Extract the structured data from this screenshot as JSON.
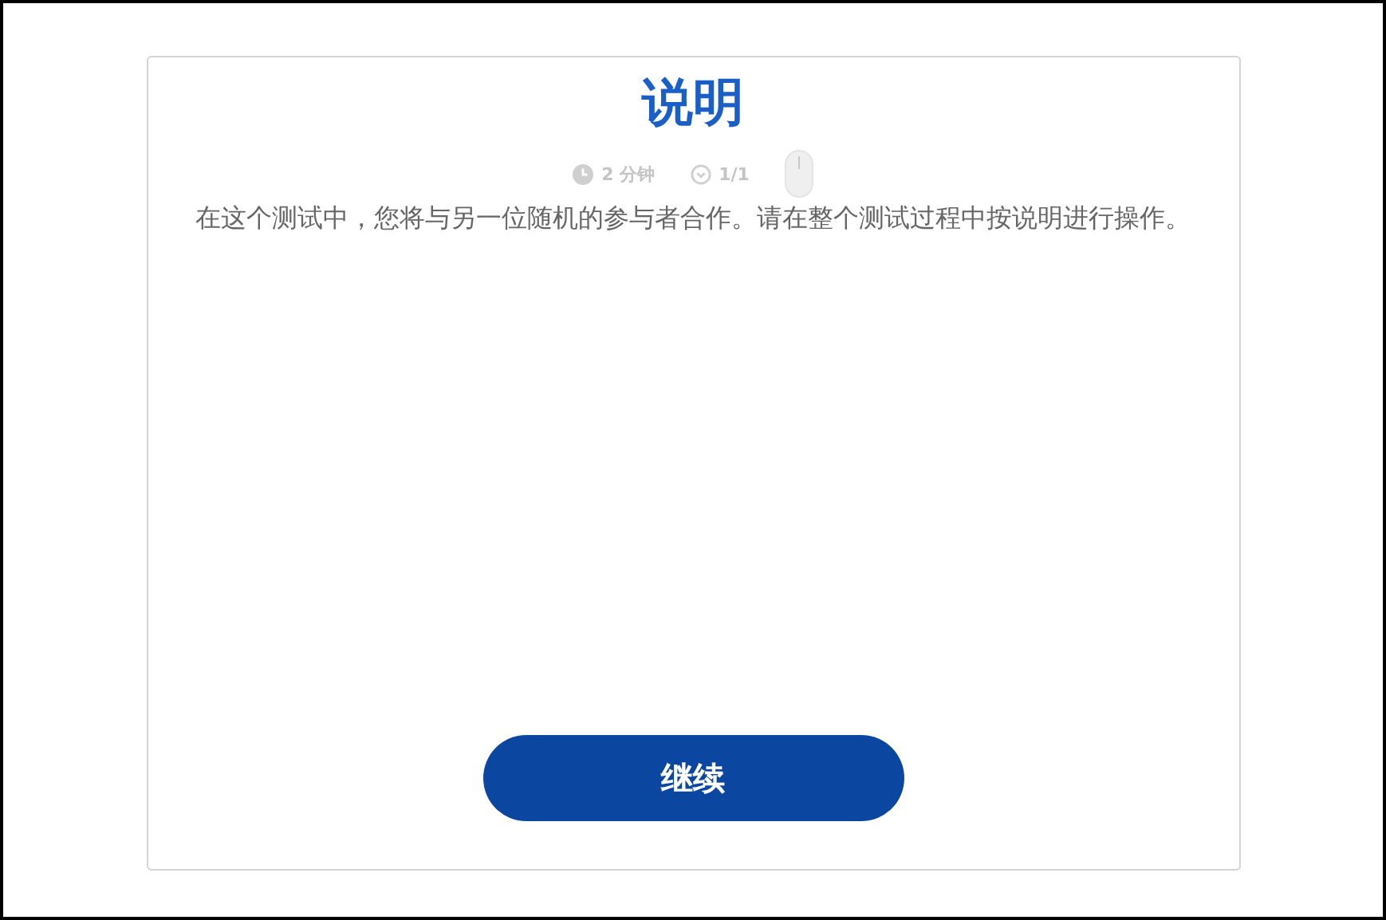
{
  "title": "说明",
  "meta": [
    {
      "kind": "time",
      "label": "2 分钟"
    },
    {
      "kind": "progress",
      "label": "1/1"
    },
    {
      "kind": "mouse"
    }
  ],
  "body": "在这个测试中，您将与另一位随机的参与者合作。请在整个测试过程中按说明进行操作。",
  "button": "继续"
}
